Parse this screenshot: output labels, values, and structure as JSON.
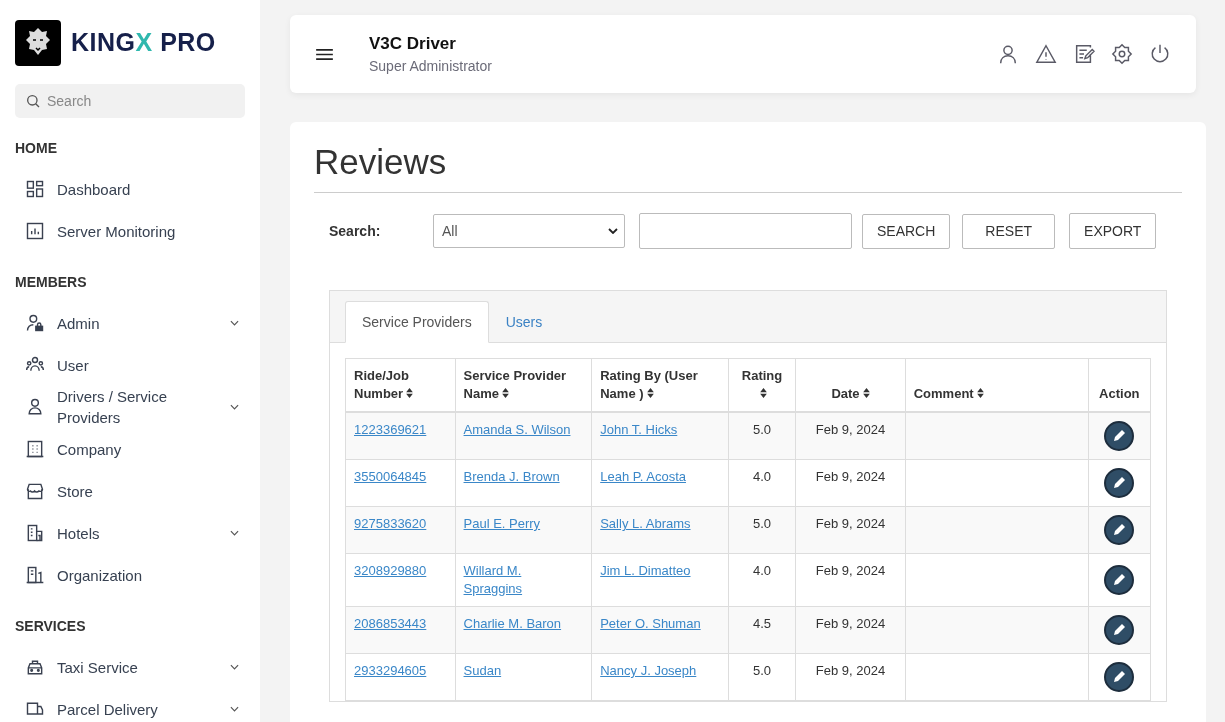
{
  "brand": {
    "name_start": "KING",
    "name_accent": "X",
    "name_end": " PRO"
  },
  "sidebar": {
    "search": {
      "placeholder": "Search"
    },
    "sections": [
      {
        "title": "HOME",
        "items": [
          {
            "label": "Dashboard",
            "expandable": false
          },
          {
            "label": "Server Monitoring",
            "expandable": false
          }
        ]
      },
      {
        "title": "MEMBERS",
        "items": [
          {
            "label": "Admin",
            "expandable": true
          },
          {
            "label": "User",
            "expandable": false
          },
          {
            "label": "Drivers / Service Providers",
            "expandable": true
          },
          {
            "label": "Company",
            "expandable": false
          },
          {
            "label": "Store",
            "expandable": false
          },
          {
            "label": "Hotels",
            "expandable": true
          },
          {
            "label": "Organization",
            "expandable": false
          }
        ]
      },
      {
        "title": "SERVICES",
        "items": [
          {
            "label": "Taxi Service",
            "expandable": true
          },
          {
            "label": "Parcel Delivery",
            "expandable": true
          }
        ]
      }
    ]
  },
  "header": {
    "title": "V3C Driver",
    "subtitle": "Super Administrator"
  },
  "page": {
    "title": "Reviews",
    "search_label": "Search:",
    "filter": {
      "value": "All"
    },
    "buttons": [
      "SEARCH",
      "RESET",
      "EXPORT"
    ]
  },
  "tabs": [
    {
      "label": "Service Providers",
      "selected": true
    },
    {
      "label": "Users",
      "selected": false
    }
  ],
  "table": {
    "columns": [
      {
        "label": "Ride/Job Number",
        "sortable": true
      },
      {
        "label": "Service Provider Name",
        "sortable": true
      },
      {
        "label": "Rating By (User Name )",
        "sortable": true
      },
      {
        "label": "Rating",
        "sortable": true
      },
      {
        "label": "Date",
        "sortable": true
      },
      {
        "label": "Comment",
        "sortable": true
      },
      {
        "label": "Action",
        "sortable": false
      }
    ],
    "rows": [
      {
        "number": "1223369621",
        "provider": "Amanda S. Wilson",
        "user": "John T. Hicks",
        "rating": "5.0",
        "date": "Feb 9, 2024"
      },
      {
        "number": "3550064845",
        "provider": "Brenda J. Brown",
        "user": "Leah P. Acosta",
        "rating": "4.0",
        "date": "Feb 9, 2024"
      },
      {
        "number": "9275833620",
        "provider": "Paul E. Perry",
        "user": "Sally L. Abrams",
        "rating": "5.0",
        "date": "Feb 9, 2024"
      },
      {
        "number": "3208929880",
        "provider": "Willard M. Spraggins",
        "user": "Jim L. Dimatteo",
        "rating": "4.0",
        "date": "Feb 9, 2024"
      },
      {
        "number": "2086853443",
        "provider": "Charlie M. Baron",
        "user": "Peter O. Shuman",
        "rating": "4.5",
        "date": "Feb 9, 2024"
      },
      {
        "number": "2933294605",
        "provider": "Sudan",
        "user": "Nancy J. Joseph",
        "rating": "5.0",
        "date": "Feb 9, 2024"
      }
    ]
  }
}
